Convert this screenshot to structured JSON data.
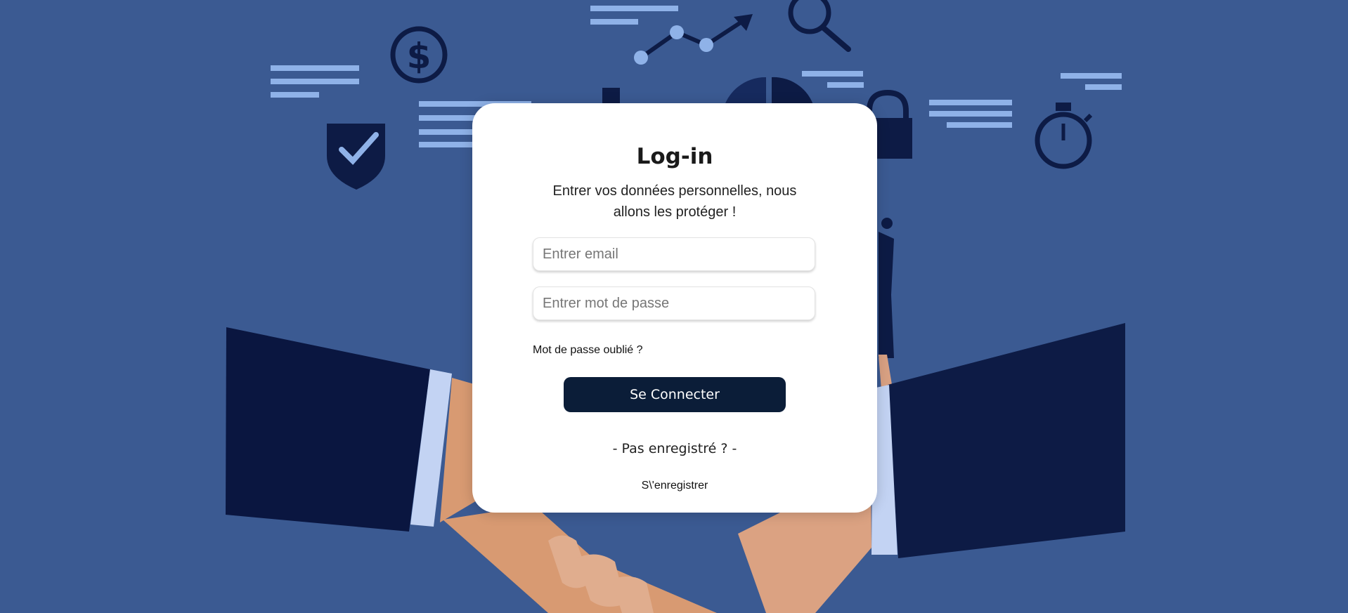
{
  "colors": {
    "background": "#3b5a92",
    "accent": "#0b1d38",
    "card": "#ffffff"
  },
  "login": {
    "title": "Log-in",
    "subtitle": "Entrer vos données personnelles, nous allons les protéger !",
    "email_placeholder": "Entrer email",
    "password_placeholder": "Entrer mot de passe",
    "forgot_label": "Mot de passe oublié ?",
    "submit_label": "Se Connecter",
    "not_registered": "- Pas enregistré ? -",
    "register_label": "S\\'enregistrer"
  },
  "background_icons": [
    "dollar-icon",
    "shield-check-icon",
    "chart-line-icon",
    "search-icon",
    "pie-chart-icon",
    "lock-icon",
    "stopwatch-icon",
    "handshake-illustration"
  ]
}
